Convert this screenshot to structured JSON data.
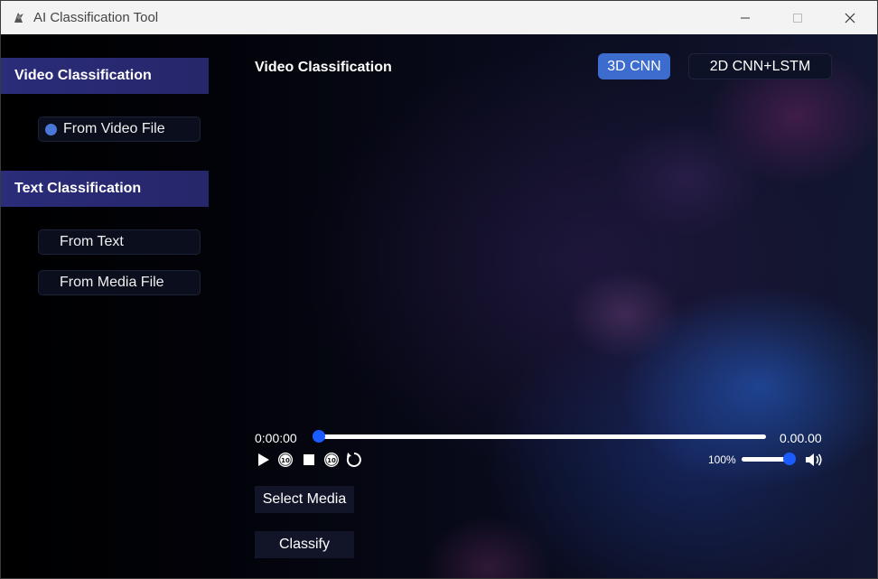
{
  "window": {
    "title": "AI Classification Tool"
  },
  "sidebar": {
    "sections": [
      {
        "title": "Video Classification",
        "items": [
          {
            "label": "From Video File",
            "selected": true
          }
        ]
      },
      {
        "title": "Text Classification",
        "items": [
          {
            "label": "From Text"
          },
          {
            "label": "From Media File"
          }
        ]
      }
    ]
  },
  "main": {
    "title": "Video Classification",
    "models": [
      {
        "label": "3D CNN",
        "active": true
      },
      {
        "label": "2D CNN+LSTM",
        "active": false
      }
    ],
    "player": {
      "current_time": "0:00:00",
      "duration": "0.00.00",
      "progress": 0,
      "volume_label": "100%",
      "volume": 1.0,
      "icons": [
        "play-icon",
        "rewind-10-icon",
        "stop-icon",
        "forward-10-icon",
        "restart-icon",
        "speaker-icon"
      ]
    },
    "actions": {
      "select_media": "Select Media",
      "classify": "Classify"
    }
  },
  "colors": {
    "accent": "#3d6ccf",
    "slider": "#1a5cff",
    "section_header": "#2b2c7a"
  }
}
